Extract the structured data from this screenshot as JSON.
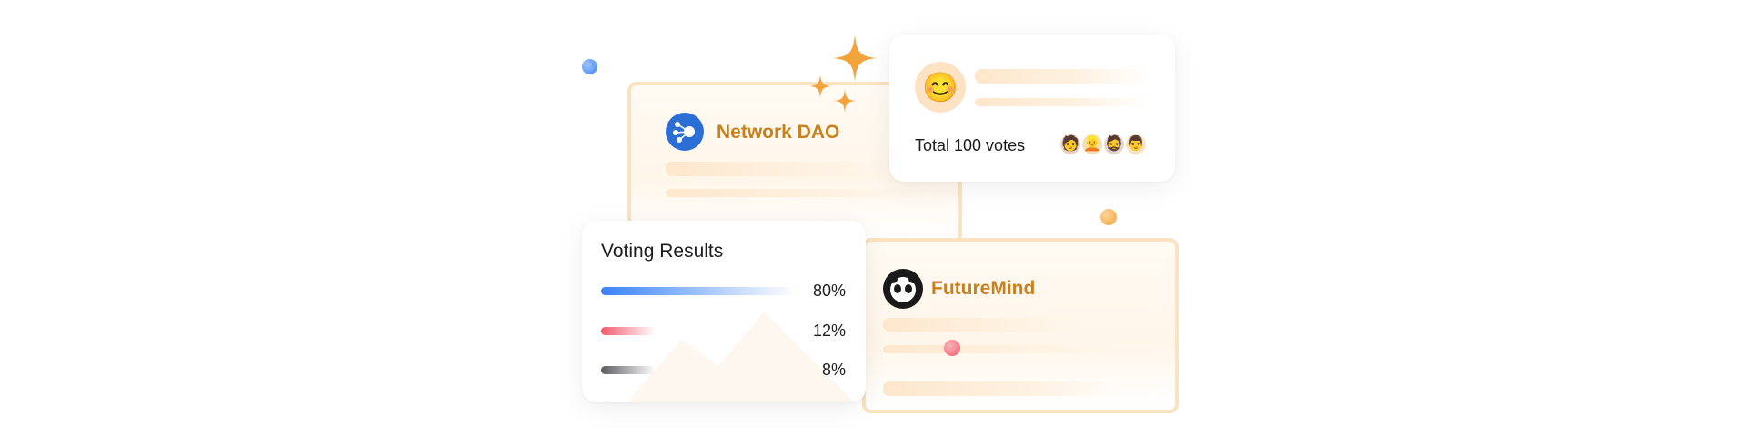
{
  "network_card": {
    "name": "Network DAO"
  },
  "futuremind_card": {
    "name": "FutureMind"
  },
  "vote_card": {
    "total_votes": "Total 100 votes",
    "emoji": "😊",
    "voters": [
      "🧑",
      "👱",
      "🧔",
      "👨"
    ]
  },
  "results_card": {
    "title": "Voting Results",
    "rows": [
      {
        "percent": "80%",
        "value": 80,
        "color": "#3b82f6"
      },
      {
        "percent": "12%",
        "value": 12,
        "color": "#ef5a6a"
      },
      {
        "percent": "8%",
        "value": 8,
        "color": "#5b5b5f"
      }
    ]
  },
  "colors": {
    "brand_orange": "#c9801e",
    "sparkle": "#f2a33c",
    "dao_blue": "#2b6fd6"
  }
}
